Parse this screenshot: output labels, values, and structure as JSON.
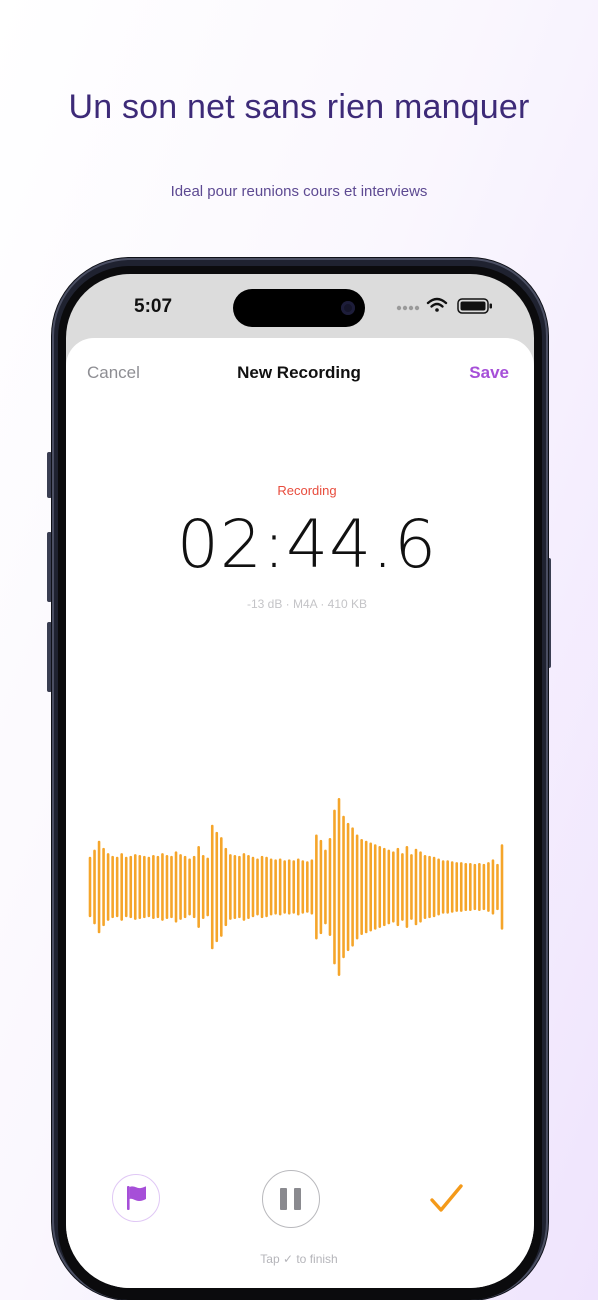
{
  "marketing": {
    "headline": "Un son net sans rien manquer",
    "subheadline": "Ideal pour reunions cours et interviews"
  },
  "status_bar": {
    "time": "5:07",
    "icons": [
      "signal-dots-icon",
      "wifi-icon",
      "battery-icon"
    ]
  },
  "nav": {
    "cancel_label": "Cancel",
    "title": "New Recording",
    "save_label": "Save"
  },
  "recording": {
    "status": "Recording",
    "timer": "02:44.6",
    "meta": "-13 dB · M4A · 410 KB"
  },
  "waveform": {
    "levels": [
      0.34,
      0.42,
      0.52,
      0.44,
      0.38,
      0.35,
      0.34,
      0.38,
      0.34,
      0.35,
      0.37,
      0.36,
      0.35,
      0.34,
      0.36,
      0.35,
      0.38,
      0.36,
      0.35,
      0.4,
      0.37,
      0.35,
      0.32,
      0.35,
      0.46,
      0.36,
      0.33,
      0.7,
      0.62,
      0.56,
      0.44,
      0.37,
      0.36,
      0.35,
      0.38,
      0.36,
      0.34,
      0.32,
      0.35,
      0.34,
      0.32,
      0.31,
      0.32,
      0.3,
      0.31,
      0.3,
      0.32,
      0.3,
      0.29,
      0.31,
      0.59,
      0.53,
      0.42,
      0.55,
      0.87,
      1.0,
      0.8,
      0.72,
      0.67,
      0.59,
      0.54,
      0.52,
      0.5,
      0.48,
      0.46,
      0.44,
      0.42,
      0.4,
      0.44,
      0.38,
      0.46,
      0.37,
      0.43,
      0.4,
      0.36,
      0.35,
      0.34,
      0.32,
      0.3,
      0.3,
      0.29,
      0.28,
      0.28,
      0.27,
      0.27,
      0.26,
      0.27,
      0.26,
      0.28,
      0.31,
      0.26,
      0.48
    ]
  },
  "controls": {
    "flag_icon": "flag-icon",
    "pause_icon": "pause-icon",
    "finish_icon": "checkmark-icon",
    "hint": "Tap ✓ to finish"
  },
  "colors": {
    "accent": "#a64fd8",
    "recording": "#e84c3d",
    "waveform": "#f5a52a",
    "finish": "#f49a1a",
    "headline": "#3d2a78"
  }
}
